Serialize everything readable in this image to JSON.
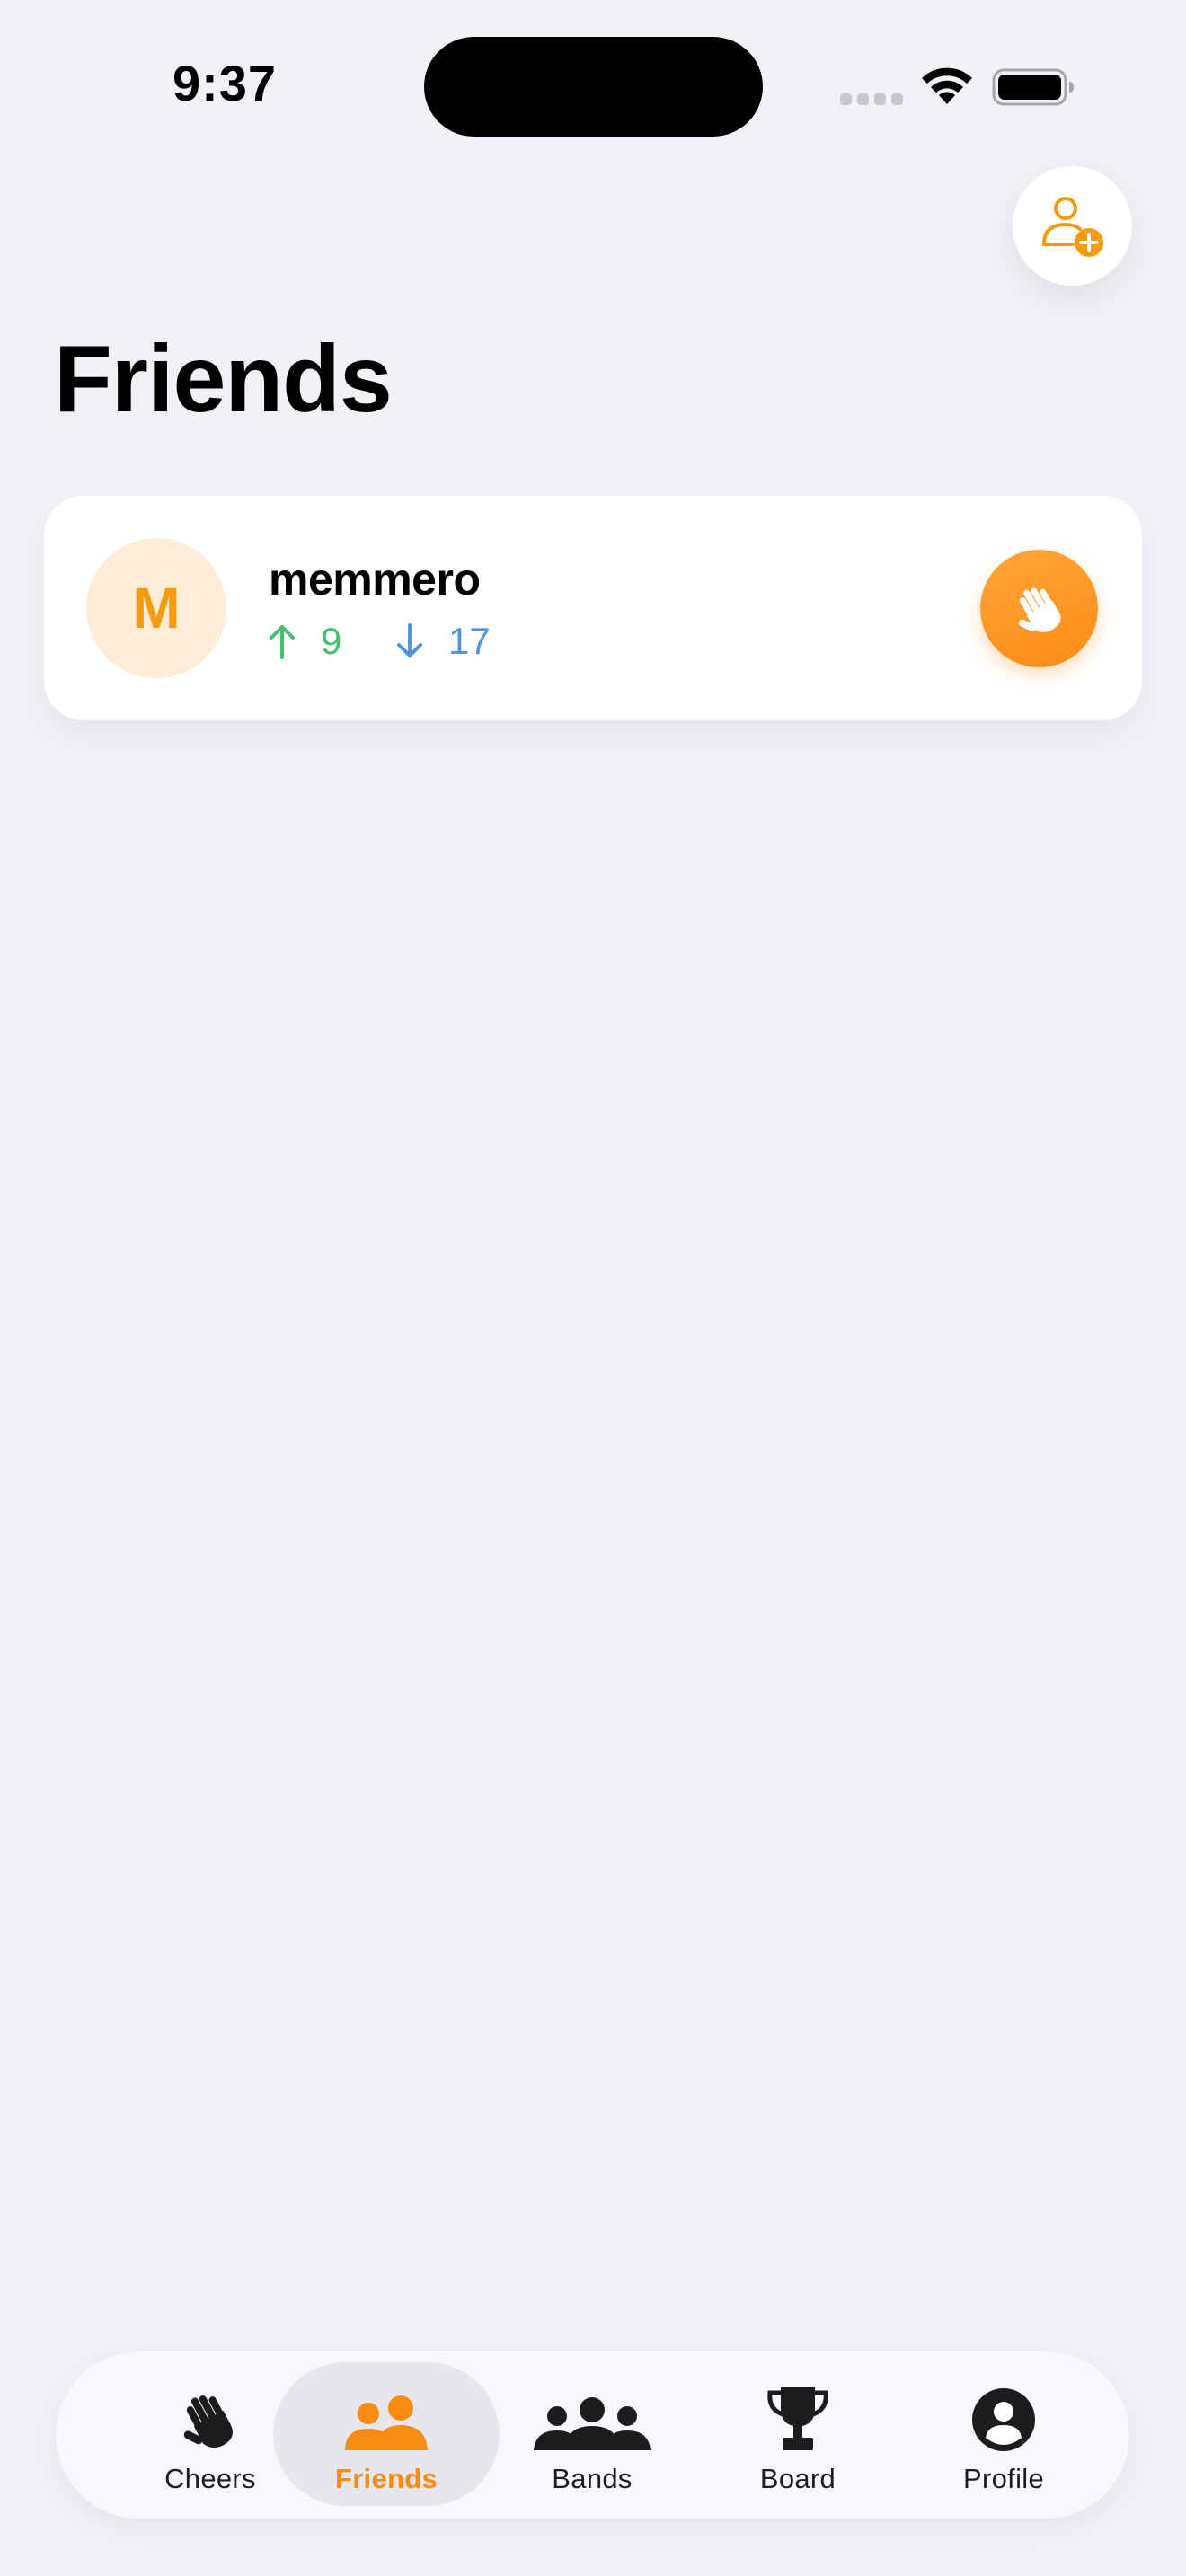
{
  "status_bar": {
    "time": "9:37"
  },
  "header": {
    "title": "Friends",
    "add_friend_icon": "person-add-icon"
  },
  "friends": [
    {
      "initial": "M",
      "name": "memmero",
      "sent_count": "9",
      "received_count": "17",
      "action_icon": "waving-hand-icon"
    }
  ],
  "tab_bar": {
    "tabs": [
      {
        "label": "Cheers",
        "icon": "waving-hand-icon",
        "active": false
      },
      {
        "label": "Friends",
        "icon": "two-people-icon",
        "active": true
      },
      {
        "label": "Bands",
        "icon": "group-icon",
        "active": false
      },
      {
        "label": "Board",
        "icon": "trophy-icon",
        "active": false
      },
      {
        "label": "Profile",
        "icon": "person-circle-icon",
        "active": false
      }
    ]
  },
  "colors": {
    "accent": "#f68c12",
    "background": "#f2f1f6",
    "up": "#48bf6f",
    "down": "#4e95dc",
    "avatar_bg": "#fdecd6"
  }
}
